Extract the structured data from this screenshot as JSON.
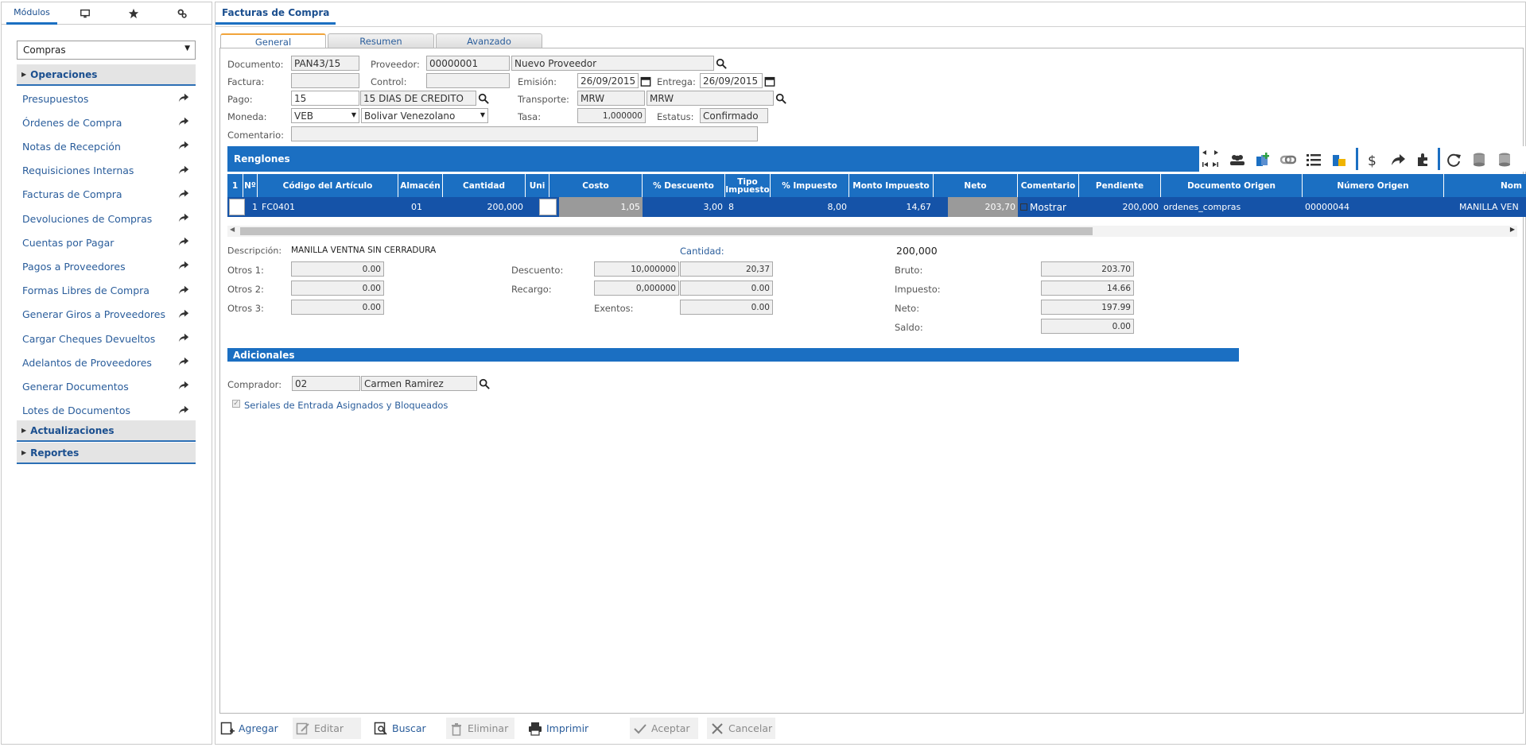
{
  "sidebar": {
    "tabs": {
      "modules_label": "Módulos",
      "monitor_icon": "monitor-icon",
      "favorites_icon": "star-icon",
      "settings_icon": "gears-icon"
    },
    "module_select": "Compras",
    "groups": {
      "operations": "Operaciones",
      "updates": "Actualizaciones",
      "reports": "Reportes"
    },
    "items": [
      "Presupuestos",
      "Órdenes de Compra",
      "Notas de Recepción",
      "Requisiciones Internas",
      "Facturas de Compra",
      "Devoluciones de Compras",
      "Cuentas por Pagar",
      "Pagos a Proveedores",
      "Formas Libres de Compra",
      "Generar Giros a Proveedores",
      "Cargar Cheques Devueltos",
      "Adelantos de Proveedores",
      "Generar Documentos",
      "Lotes de Documentos"
    ]
  },
  "window": {
    "title": "Facturas de Compra"
  },
  "tabs": [
    "General",
    "Resumen",
    "Avanzado"
  ],
  "form": {
    "documento_label": "Documento:",
    "documento": "PAN43/15",
    "proveedor_label": "Proveedor:",
    "proveedor_code": "00000001",
    "proveedor_name": "Nuevo Proveedor",
    "factura_label": "Factura:",
    "factura": "",
    "control_label": "Control:",
    "control": "",
    "emision_label": "Emisión:",
    "emision": "26/09/2015",
    "entrega_label": "Entrega:",
    "entrega": "26/09/2015",
    "pago_label": "Pago:",
    "pago_code": "15",
    "pago_desc": "15 DIAS DE CREDITO",
    "transporte_label": "Transporte:",
    "transporte_code": "MRW",
    "transporte_name": "MRW",
    "moneda_label": "Moneda:",
    "moneda_code": "VEB",
    "moneda_name": "Bolivar Venezolano",
    "tasa_label": "Tasa:",
    "tasa": "1,000000",
    "estatus_label": "Estatus:",
    "estatus": "Confirmado",
    "comentario_label": "Comentario:",
    "comentario": ""
  },
  "renglones": {
    "title": "Renglones",
    "columns": [
      "1",
      "Nº",
      "Código del Artículo",
      "Almacén",
      "Cantidad",
      "Uni",
      "Costo",
      "% Descuento",
      "Tipo Impuesto",
      "% Impuesto",
      "Monto Impuesto",
      "Neto",
      "Comentario",
      "Pendiente",
      "Documento Origen",
      "Número Origen",
      "Nom"
    ],
    "row": {
      "n": "1",
      "codigo": "FC0401",
      "almacen": "01",
      "cantidad": "200,000",
      "costo": "1,05",
      "descuento": "3,00",
      "tipo_impuesto": "8",
      "pct_impuesto": "8,00",
      "monto_impuesto": "14,67",
      "neto": "203,70",
      "comentario": "Mostrar",
      "pendiente": "200,000",
      "doc_origen": "ordenes_compras",
      "num_origen": "00000044",
      "nombre": "MANILLA VEN"
    }
  },
  "detail": {
    "descripcion_label": "Descripción:",
    "descripcion": "MANILLA VENTNA SIN CERRADURA",
    "cantidad_label": "Cantidad:",
    "cantidad": "200,000",
    "otros1_label": "Otros 1:",
    "otros1": "0.00",
    "otros2_label": "Otros 2:",
    "otros2": "0.00",
    "otros3_label": "Otros 3:",
    "otros3": "0.00",
    "descuento_label": "Descuento:",
    "descuento_pct": "10,000000",
    "descuento_monto": "20,37",
    "recargo_label": "Recargo:",
    "recargo_pct": "0,000000",
    "recargo_monto": "0.00",
    "exentos_label": "Exentos:",
    "exentos": "0.00",
    "bruto_label": "Bruto:",
    "bruto": "203.70",
    "impuesto_label": "Impuesto:",
    "impuesto": "14.66",
    "neto_label": "Neto:",
    "neto": "197.99",
    "saldo_label": "Saldo:",
    "saldo": "0.00"
  },
  "adicionales": {
    "title": "Adicionales",
    "comprador_label": "Comprador:",
    "comprador_code": "02",
    "comprador_name": "Carmen Ramirez",
    "seriales_label": "Seriales de Entrada Asignados y Bloqueados"
  },
  "actions": {
    "agregar": "Agregar",
    "editar": "Editar",
    "buscar": "Buscar",
    "eliminar": "Eliminar",
    "imprimir": "Imprimir",
    "aceptar": "Aceptar",
    "cancelar": "Cancelar"
  },
  "colors": {
    "accent": "#1b6fc2",
    "row_selected": "#1553a8",
    "link": "#2a5d9b",
    "tab_active_top": "#f1a43a"
  }
}
